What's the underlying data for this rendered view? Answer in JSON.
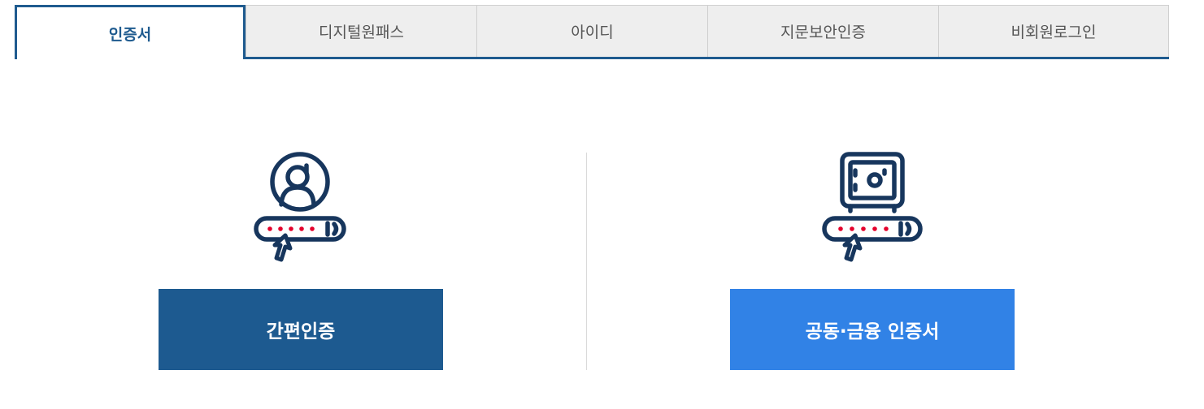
{
  "tabs": [
    {
      "label": "인증서",
      "active": true
    },
    {
      "label": "디지털원패스",
      "active": false
    },
    {
      "label": "아이디",
      "active": false
    },
    {
      "label": "지문보안인증",
      "active": false
    },
    {
      "label": "비회원로그인",
      "active": false
    }
  ],
  "options": {
    "simple_auth": {
      "label": "간편인증",
      "icon": "user-password-icon",
      "color": "#1d5a90"
    },
    "certificate": {
      "label": "공동·금융 인증서",
      "icon": "safe-password-icon",
      "color": "#3182e6"
    }
  },
  "colors": {
    "accent": "#1f5b8f",
    "icon_stroke": "#17365d",
    "password_dots": "#e5002b"
  }
}
